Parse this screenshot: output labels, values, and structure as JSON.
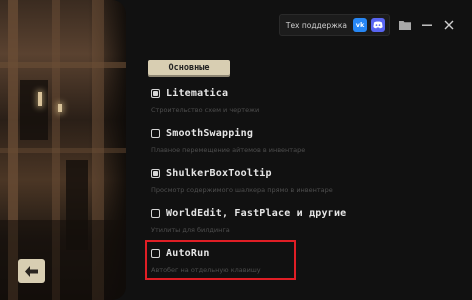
{
  "header": {
    "support_label": "Тех поддержка",
    "vk_label": "vk",
    "discord_label": "discord-icon",
    "folder_icon": "folder-icon",
    "minimize_icon": "minimize-icon",
    "close_icon": "close-icon"
  },
  "section": {
    "title": "Основные"
  },
  "mods": [
    {
      "name": "Litematica",
      "description": "Строительство схем и чертежи",
      "checked": true
    },
    {
      "name": "SmoothSwapping",
      "description": "Плавное перемещение айтемов в инвентаре",
      "checked": false
    },
    {
      "name": "ShulkerBoxTooltip",
      "description": "Просмотр содержимого шалкера прямо в инвентаре",
      "checked": true
    },
    {
      "name": "WorldEdit, FastPlace и другие",
      "description": "Утилиты для билдинга",
      "checked": false
    },
    {
      "name": "AutoRun",
      "description": "Автобег на отдельную клавишу",
      "checked": false
    }
  ],
  "highlighted_item": "AutoRun",
  "back_button": {
    "icon": "arrow-left-icon"
  },
  "colors": {
    "background": "#111111",
    "accent_beige": "#d8ceb2",
    "highlight_red": "#e01e25",
    "vk_blue": "#2787f5",
    "discord_blurple": "#5865f2"
  }
}
